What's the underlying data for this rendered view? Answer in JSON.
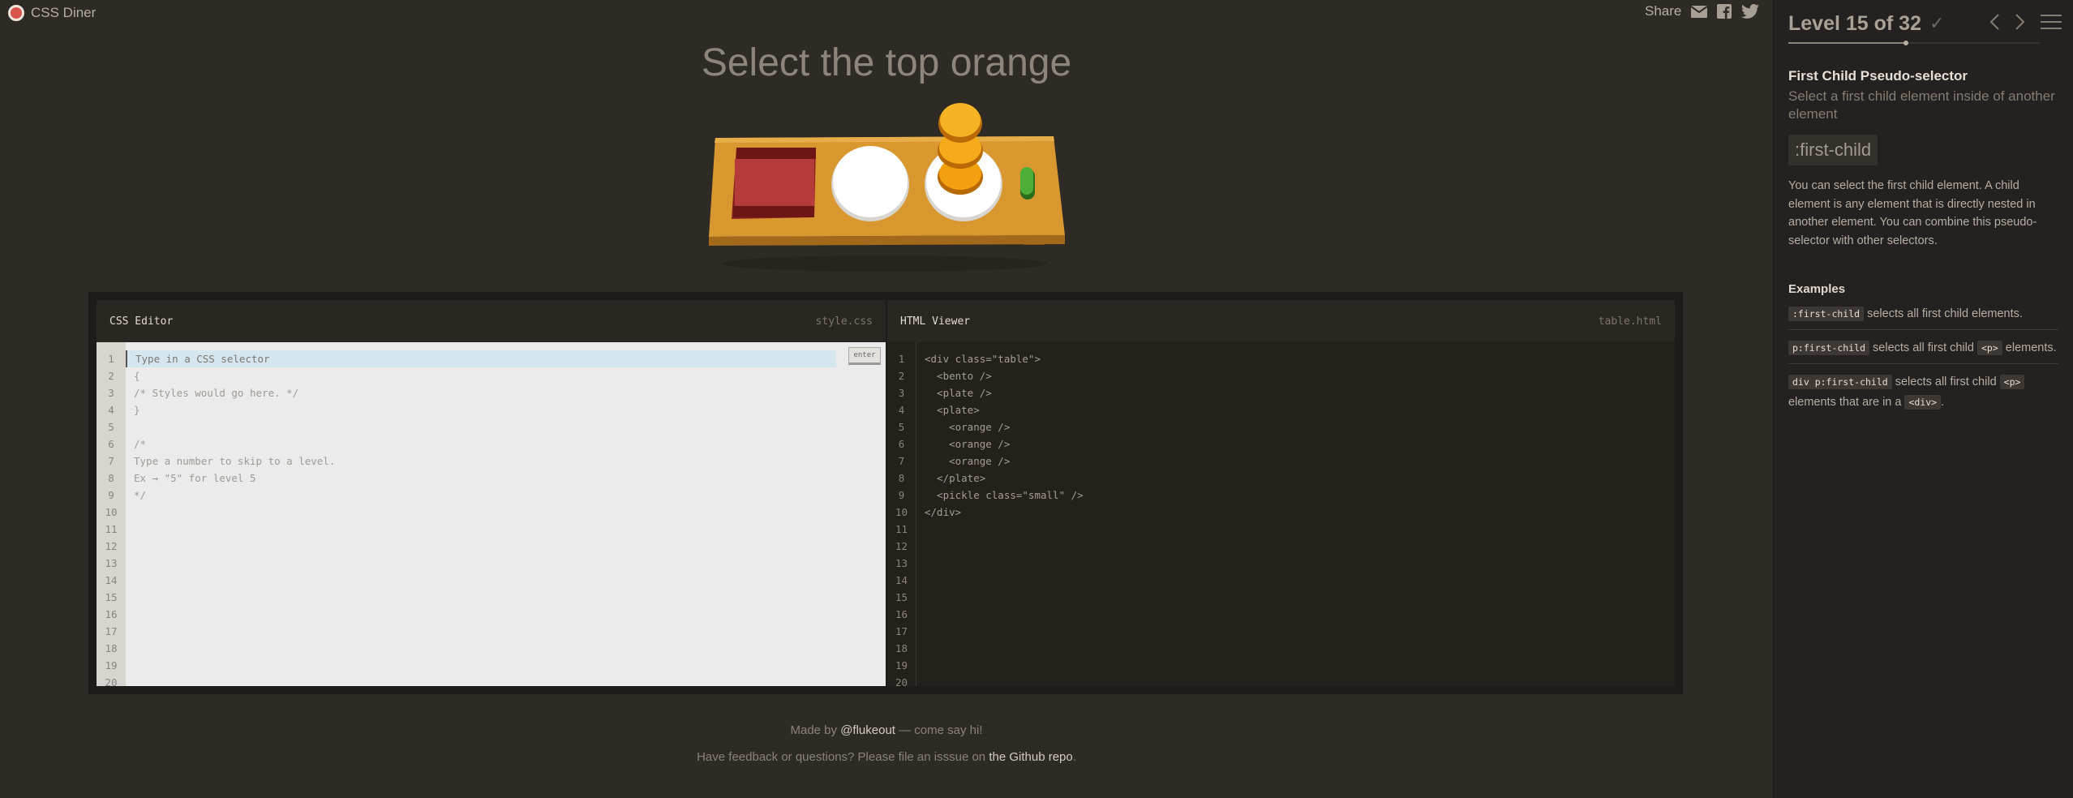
{
  "app": {
    "title": "CSS Diner"
  },
  "share": {
    "label": "Share"
  },
  "instruction": "Select the top orange",
  "css_editor": {
    "title": "CSS Editor",
    "filename": "style.css",
    "placeholder": "Type in a CSS selector",
    "enter_label": "enter",
    "lines": [
      "",
      "{",
      "/* Styles would go here. */",
      "}",
      "",
      "/*",
      "Type a number to skip to a level.",
      "Ex → \"5\" for level 5",
      "*/",
      "",
      "",
      "",
      "",
      "",
      "",
      "",
      "",
      "",
      "",
      ""
    ],
    "line_numbers": [
      "1",
      "2",
      "3",
      "4",
      "5",
      "6",
      "7",
      "8",
      "9",
      "10",
      "11",
      "12",
      "13",
      "14",
      "15",
      "16",
      "17",
      "18",
      "19",
      "20"
    ]
  },
  "html_viewer": {
    "title": "HTML Viewer",
    "filename": "table.html",
    "lines": [
      "<div class=\"table\">",
      "  <bento />",
      "  <plate />",
      "  <plate>",
      "    <orange />",
      "    <orange />",
      "    <orange />",
      "  </plate>",
      "  <pickle class=\"small\" />",
      "</div>",
      "",
      "",
      "",
      "",
      "",
      "",
      "",
      "",
      "",
      ""
    ],
    "line_numbers": [
      "1",
      "2",
      "3",
      "4",
      "5",
      "6",
      "7",
      "8",
      "9",
      "10",
      "11",
      "12",
      "13",
      "14",
      "15",
      "16",
      "17",
      "18",
      "19",
      "20"
    ]
  },
  "footer": {
    "made_by_prefix": "Made by ",
    "author": "@flukeout",
    "made_by_suffix": " — come say hi!",
    "feedback_prefix": "Have feedback or questions? Please file an isssue on ",
    "repo_link": "the Github repo",
    "feedback_suffix": "."
  },
  "sidebar": {
    "level_title": "Level 15 of 32",
    "current_level": 15,
    "total_levels": 32,
    "heading": "First Child Pseudo-selector",
    "subheading": "Select a first child element inside of another element",
    "selector": ":first-child",
    "description": "You can select the first child element. A child element is any element that is directly nested in another element. You can combine this pseudo-selector with other selectors.",
    "examples_title": "Examples",
    "examples": [
      {
        "parts": [
          {
            "code": ":first-child"
          },
          {
            "text": " selects all first child elements."
          }
        ]
      },
      {
        "parts": [
          {
            "code": "p:first-child"
          },
          {
            "text": " selects all first child "
          },
          {
            "code": "<p>"
          },
          {
            "text": " elements."
          }
        ]
      },
      {
        "parts": [
          {
            "code": "div p:first-child"
          },
          {
            "text": " selects all first child "
          },
          {
            "code": "<p>"
          },
          {
            "text": " elements that are in a "
          },
          {
            "code": "<div>"
          },
          {
            "text": "."
          }
        ]
      }
    ]
  },
  "colors": {
    "background": "#2e2a25",
    "sidebar": "#242120",
    "table_wood": "#dba03a",
    "orange": "#f2a20e",
    "bento": "#9a2a2a",
    "pickle": "#3f9c2e"
  },
  "icons": [
    "mail-icon",
    "facebook-icon",
    "twitter-icon",
    "check-icon",
    "prev-icon",
    "next-icon",
    "menu-icon"
  ]
}
